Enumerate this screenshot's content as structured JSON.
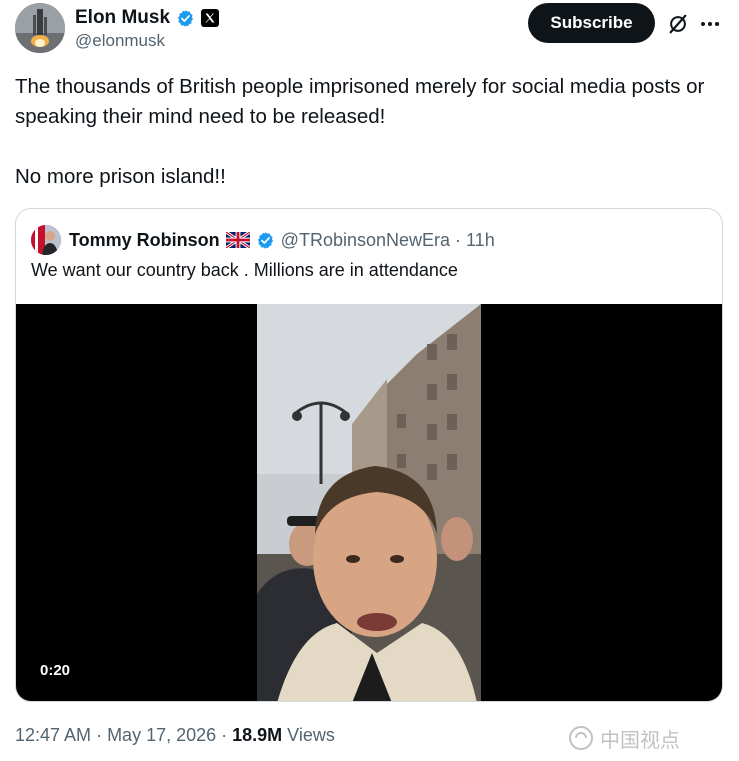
{
  "author": {
    "display_name": "Elon Musk",
    "handle": "@elonmusk",
    "verified": true,
    "affiliation_badge": "x-logo-icon"
  },
  "header_actions": {
    "subscribe_label": "Subscribe",
    "grok_icon": "grok-icon",
    "more_icon": "more-icon"
  },
  "post": {
    "paragraph_1": "The thousands of British people imprisoned merely for social media posts or speaking their mind need to be released!",
    "paragraph_2": "No more prison island!!"
  },
  "quoted_post": {
    "display_name": "Tommy Robinson",
    "flag_icon": "uk-flag-icon",
    "verified": true,
    "handle_time": "@TRobinsonNewEra · 11h",
    "text": "We want our country back . Millions are in attendance",
    "video_duration": "0:20"
  },
  "meta": {
    "time": "12:47 AM",
    "separator": "·",
    "date": "May 17, 2026",
    "views_count": "18.9M",
    "views_label": "Views"
  },
  "watermark": {
    "text": "中国视点"
  },
  "colors": {
    "text_primary": "#0f1419",
    "text_secondary": "#536471",
    "verified_blue": "#1d9bf0",
    "border": "#cfd9de"
  }
}
